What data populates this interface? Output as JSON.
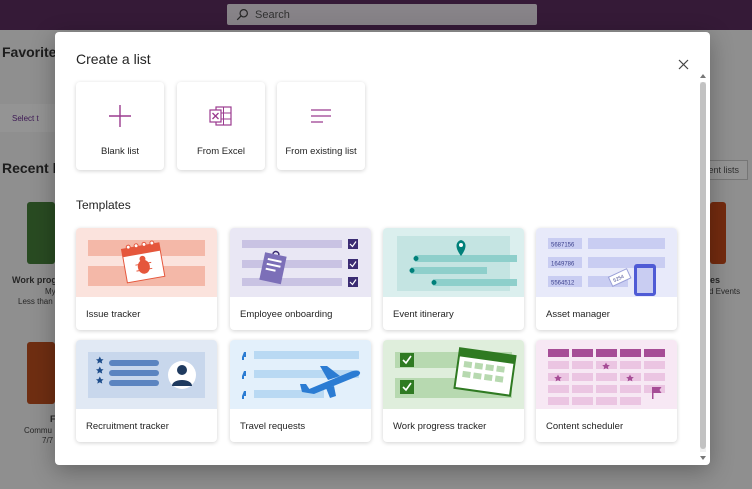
{
  "header": {
    "search_placeholder": "Search"
  },
  "background": {
    "favorites_heading": "Favorites",
    "select_hint": "Select t",
    "recent_heading": "Recent lis",
    "recent_button": "ent lists",
    "tile1_title": "Work prog",
    "tile1_sub1": "My",
    "tile1_sub2": "Less than a",
    "tile2_title": "F",
    "tile2_sub1": "Commu",
    "tile2_sub2": "7/7",
    "tile3_title": "es",
    "tile3_sub": "d Events"
  },
  "dialog": {
    "title": "Create a list",
    "create_options": [
      {
        "label": "Blank list",
        "icon": "plus-icon"
      },
      {
        "label": "From Excel",
        "icon": "excel-icon"
      },
      {
        "label": "From existing list",
        "icon": "lines-icon"
      }
    ],
    "templates_heading": "Templates",
    "templates": [
      {
        "label": "Issue tracker",
        "color": "#fbe3dd"
      },
      {
        "label": "Employee onboarding",
        "color": "#e9e7f4"
      },
      {
        "label": "Event itinerary",
        "color": "#dbefee"
      },
      {
        "label": "Asset manager",
        "color": "#e8eafa"
      },
      {
        "label": "Recruitment tracker",
        "color": "#e1e9f4"
      },
      {
        "label": "Travel requests",
        "color": "#e3f0fb"
      },
      {
        "label": "Work progress tracker",
        "color": "#dfeedc"
      },
      {
        "label": "Content scheduler",
        "color": "#f7e8f4"
      }
    ],
    "asset_numbers": [
      "5687156",
      "1649786",
      "5564512",
      "5254"
    ]
  },
  "colors": {
    "brand": "#5c2e60",
    "accent": "#9b3b8f"
  }
}
